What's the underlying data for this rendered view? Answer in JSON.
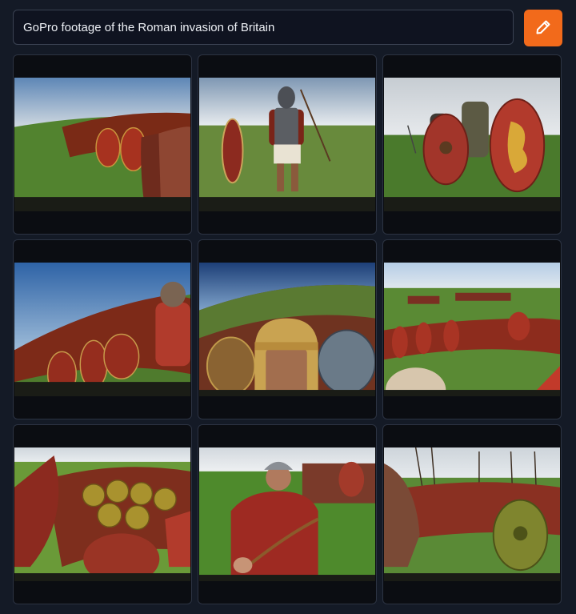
{
  "prompt": {
    "value": "GoPro footage of the Roman invasion of Britain"
  },
  "generate_button": {
    "icon": "pencil-icon"
  },
  "colors": {
    "accent": "#f26a1b",
    "background": "#141a26"
  },
  "results": [
    {
      "scene": "shield-wall-field"
    },
    {
      "scene": "legionary-standing"
    },
    {
      "scene": "soldiers-with-shields"
    },
    {
      "scene": "fisheye-shield-row"
    },
    {
      "scene": "gold-helmet-closeup"
    },
    {
      "scene": "legion-in-field"
    },
    {
      "scene": "tilted-shield-wall"
    },
    {
      "scene": "legionary-with-bow"
    },
    {
      "scene": "spear-formation"
    }
  ]
}
